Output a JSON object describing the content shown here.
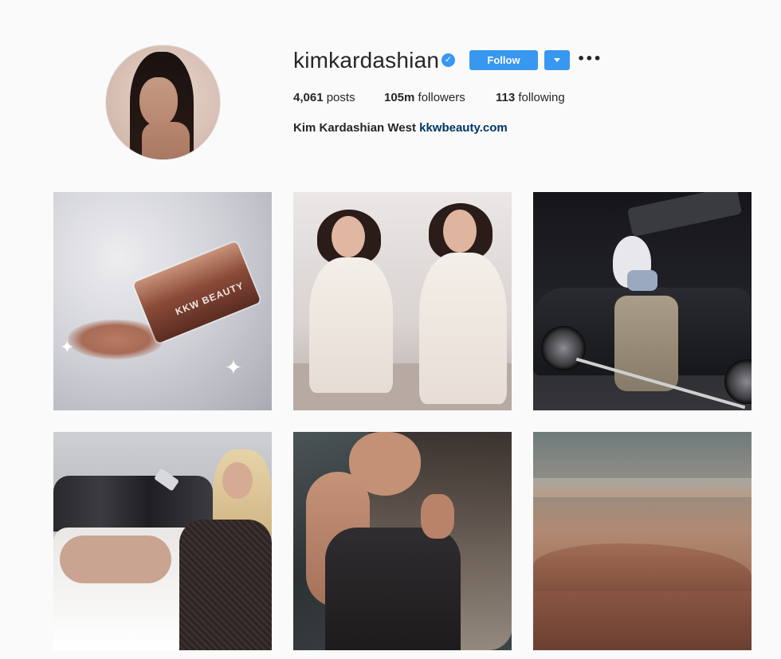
{
  "profile": {
    "username": "kimkardashian",
    "verified_icon": "verified-badge-icon",
    "follow_label": "Follow",
    "dropdown_icon": "chevron-down-icon",
    "more_label": "•••",
    "stats": {
      "posts_count": "4,061",
      "posts_label": " posts",
      "followers_count": "105m",
      "followers_label": " followers",
      "following_count": "113",
      "following_label": " following"
    },
    "bio": {
      "name": "Kim Kardashian West",
      "link": "kkwbeauty.com"
    }
  },
  "posts": [
    {
      "id": "post-1",
      "product_text": "KKW BEAUTY"
    },
    {
      "id": "post-2"
    },
    {
      "id": "post-3"
    },
    {
      "id": "post-4"
    },
    {
      "id": "post-5"
    },
    {
      "id": "post-6"
    }
  ],
  "colors": {
    "accent": "#3897f0",
    "link": "#003569",
    "background": "#fafafa",
    "text": "#262626"
  }
}
